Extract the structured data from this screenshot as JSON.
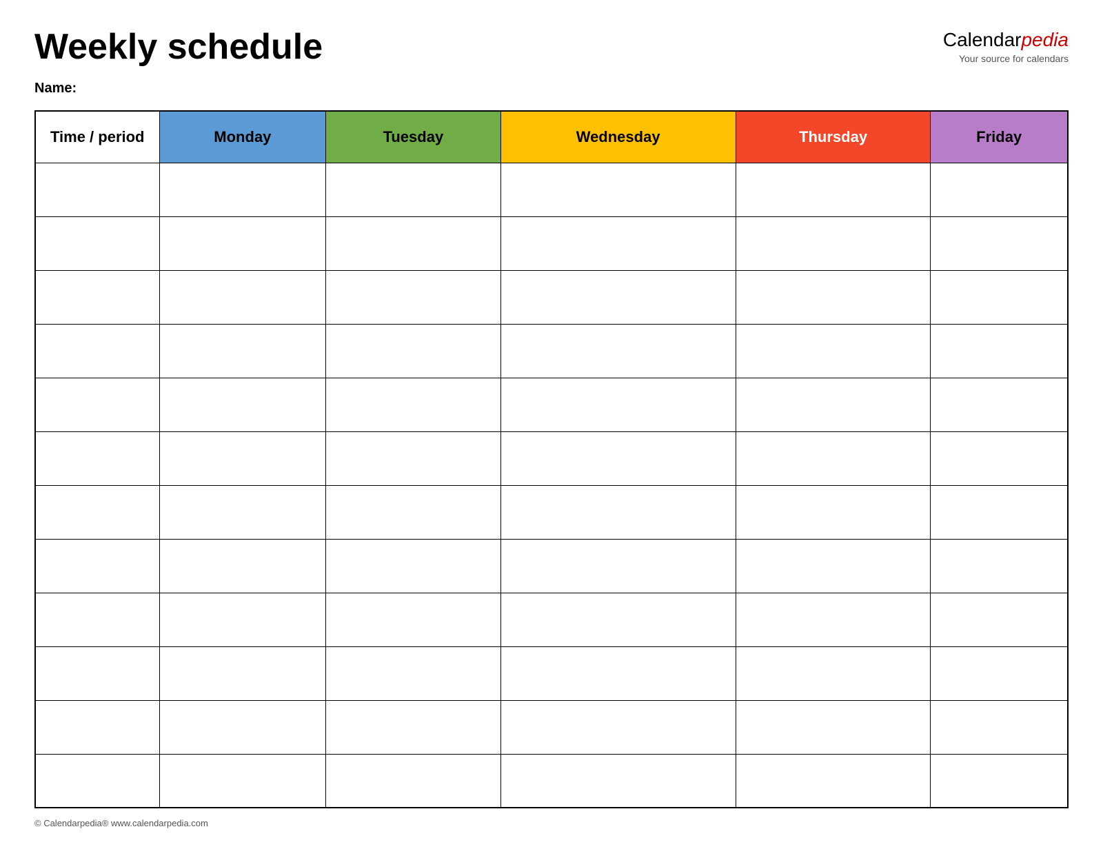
{
  "header": {
    "title": "Weekly schedule",
    "brand_calendar": "Calendar",
    "brand_pedia": "pedia",
    "brand_tagline": "Your source for calendars"
  },
  "name_label": "Name:",
  "columns": {
    "time_period": "Time / period",
    "monday": "Monday",
    "tuesday": "Tuesday",
    "wednesday": "Wednesday",
    "thursday": "Thursday",
    "friday": "Friday"
  },
  "num_rows": 12,
  "footer": "© Calendarpedia®  www.calendarpedia.com"
}
